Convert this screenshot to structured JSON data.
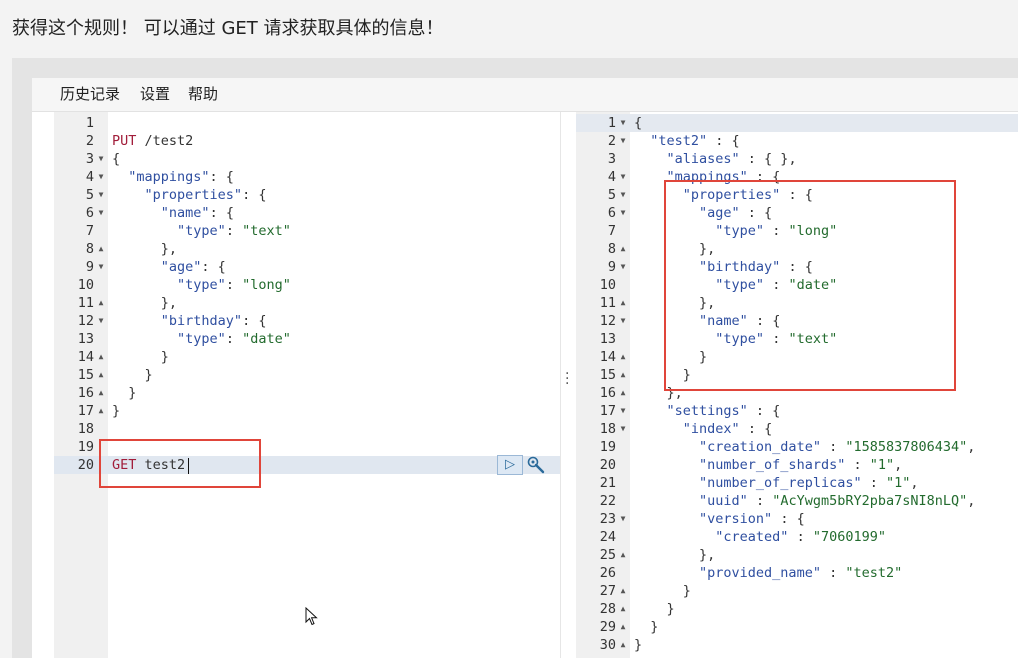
{
  "caption": "获得这个规则！ 可以通过 GET 请求获取具体的信息！",
  "menu": {
    "history": "历史记录",
    "settings": "设置",
    "help": "帮助"
  },
  "icons": {
    "run": "play-icon",
    "settings": "wrench-icon",
    "splitter": "vertical-dots-icon",
    "pointer": "mouse-cursor-icon"
  },
  "colors": {
    "accent_box": "#e0453a",
    "key": "#2f4fa0",
    "string": "#236b2e",
    "method": "#a11d3a"
  },
  "run_symbol": "▷",
  "left_editor": {
    "lines": [
      {
        "n": "1",
        "f": "",
        "t": []
      },
      {
        "n": "2",
        "f": "",
        "t": [
          [
            "m",
            "PUT"
          ],
          [
            "p",
            " /test2"
          ]
        ]
      },
      {
        "n": "3",
        "f": "▼",
        "t": [
          [
            "p",
            "{"
          ]
        ]
      },
      {
        "n": "4",
        "f": "▼",
        "t": [
          [
            "p",
            "  "
          ],
          [
            "k",
            "\"mappings\""
          ],
          [
            "p",
            ": {"
          ]
        ]
      },
      {
        "n": "5",
        "f": "▼",
        "t": [
          [
            "p",
            "    "
          ],
          [
            "k",
            "\"properties\""
          ],
          [
            "p",
            ": {"
          ]
        ]
      },
      {
        "n": "6",
        "f": "▼",
        "t": [
          [
            "p",
            "      "
          ],
          [
            "k",
            "\"name\""
          ],
          [
            "p",
            ": {"
          ]
        ]
      },
      {
        "n": "7",
        "f": "",
        "t": [
          [
            "p",
            "        "
          ],
          [
            "k",
            "\"type\""
          ],
          [
            "p",
            ": "
          ],
          [
            "s",
            "\"text\""
          ]
        ]
      },
      {
        "n": "8",
        "f": "▲",
        "t": [
          [
            "p",
            "      },"
          ]
        ]
      },
      {
        "n": "9",
        "f": "▼",
        "t": [
          [
            "p",
            "      "
          ],
          [
            "k",
            "\"age\""
          ],
          [
            "p",
            ": {"
          ]
        ]
      },
      {
        "n": "10",
        "f": "",
        "t": [
          [
            "p",
            "        "
          ],
          [
            "k",
            "\"type\""
          ],
          [
            "p",
            ": "
          ],
          [
            "s",
            "\"long\""
          ]
        ]
      },
      {
        "n": "11",
        "f": "▲",
        "t": [
          [
            "p",
            "      },"
          ]
        ]
      },
      {
        "n": "12",
        "f": "▼",
        "t": [
          [
            "p",
            "      "
          ],
          [
            "k",
            "\"birthday\""
          ],
          [
            "p",
            ": {"
          ]
        ]
      },
      {
        "n": "13",
        "f": "",
        "t": [
          [
            "p",
            "        "
          ],
          [
            "k",
            "\"type\""
          ],
          [
            "p",
            ": "
          ],
          [
            "s",
            "\"date\""
          ]
        ]
      },
      {
        "n": "14",
        "f": "▲",
        "t": [
          [
            "p",
            "      }"
          ]
        ]
      },
      {
        "n": "15",
        "f": "▲",
        "t": [
          [
            "p",
            "    }"
          ]
        ]
      },
      {
        "n": "16",
        "f": "▲",
        "t": [
          [
            "p",
            "  }"
          ]
        ]
      },
      {
        "n": "17",
        "f": "▲",
        "t": [
          [
            "p",
            "}"
          ]
        ]
      },
      {
        "n": "18",
        "f": "",
        "t": []
      },
      {
        "n": "19",
        "f": "",
        "t": []
      },
      {
        "n": "20",
        "f": "",
        "t": [
          [
            "m",
            "GET"
          ],
          [
            "p",
            " test2"
          ]
        ]
      }
    ]
  },
  "right_editor": {
    "lines": [
      {
        "n": "1",
        "f": "▼",
        "t": [
          [
            "p",
            "{"
          ]
        ]
      },
      {
        "n": "2",
        "f": "▼",
        "t": [
          [
            "p",
            "  "
          ],
          [
            "k",
            "\"test2\""
          ],
          [
            "p",
            " : {"
          ]
        ]
      },
      {
        "n": "3",
        "f": "",
        "t": [
          [
            "p",
            "    "
          ],
          [
            "k",
            "\"aliases\""
          ],
          [
            "p",
            " : { },"
          ]
        ]
      },
      {
        "n": "4",
        "f": "▼",
        "t": [
          [
            "p",
            "    "
          ],
          [
            "k",
            "\"mappings\""
          ],
          [
            "p",
            " : {"
          ]
        ]
      },
      {
        "n": "5",
        "f": "▼",
        "t": [
          [
            "p",
            "      "
          ],
          [
            "k",
            "\"properties\""
          ],
          [
            "p",
            " : {"
          ]
        ]
      },
      {
        "n": "6",
        "f": "▼",
        "t": [
          [
            "p",
            "        "
          ],
          [
            "k",
            "\"age\""
          ],
          [
            "p",
            " : {"
          ]
        ]
      },
      {
        "n": "7",
        "f": "",
        "t": [
          [
            "p",
            "          "
          ],
          [
            "k",
            "\"type\""
          ],
          [
            "p",
            " : "
          ],
          [
            "s",
            "\"long\""
          ]
        ]
      },
      {
        "n": "8",
        "f": "▲",
        "t": [
          [
            "p",
            "        },"
          ]
        ]
      },
      {
        "n": "9",
        "f": "▼",
        "t": [
          [
            "p",
            "        "
          ],
          [
            "k",
            "\"birthday\""
          ],
          [
            "p",
            " : {"
          ]
        ]
      },
      {
        "n": "10",
        "f": "",
        "t": [
          [
            "p",
            "          "
          ],
          [
            "k",
            "\"type\""
          ],
          [
            "p",
            " : "
          ],
          [
            "s",
            "\"date\""
          ]
        ]
      },
      {
        "n": "11",
        "f": "▲",
        "t": [
          [
            "p",
            "        },"
          ]
        ]
      },
      {
        "n": "12",
        "f": "▼",
        "t": [
          [
            "p",
            "        "
          ],
          [
            "k",
            "\"name\""
          ],
          [
            "p",
            " : {"
          ]
        ]
      },
      {
        "n": "13",
        "f": "",
        "t": [
          [
            "p",
            "          "
          ],
          [
            "k",
            "\"type\""
          ],
          [
            "p",
            " : "
          ],
          [
            "s",
            "\"text\""
          ]
        ]
      },
      {
        "n": "14",
        "f": "▲",
        "t": [
          [
            "p",
            "        }"
          ]
        ]
      },
      {
        "n": "15",
        "f": "▲",
        "t": [
          [
            "p",
            "      }"
          ]
        ]
      },
      {
        "n": "16",
        "f": "▲",
        "t": [
          [
            "p",
            "    },"
          ]
        ]
      },
      {
        "n": "17",
        "f": "▼",
        "t": [
          [
            "p",
            "    "
          ],
          [
            "k",
            "\"settings\""
          ],
          [
            "p",
            " : {"
          ]
        ]
      },
      {
        "n": "18",
        "f": "▼",
        "t": [
          [
            "p",
            "      "
          ],
          [
            "k",
            "\"index\""
          ],
          [
            "p",
            " : {"
          ]
        ]
      },
      {
        "n": "19",
        "f": "",
        "t": [
          [
            "p",
            "        "
          ],
          [
            "k",
            "\"creation_date\""
          ],
          [
            "p",
            " : "
          ],
          [
            "s",
            "\"1585837806434\""
          ],
          [
            "p",
            ","
          ]
        ]
      },
      {
        "n": "20",
        "f": "",
        "t": [
          [
            "p",
            "        "
          ],
          [
            "k",
            "\"number_of_shards\""
          ],
          [
            "p",
            " : "
          ],
          [
            "s",
            "\"1\""
          ],
          [
            "p",
            ","
          ]
        ]
      },
      {
        "n": "21",
        "f": "",
        "t": [
          [
            "p",
            "        "
          ],
          [
            "k",
            "\"number_of_replicas\""
          ],
          [
            "p",
            " : "
          ],
          [
            "s",
            "\"1\""
          ],
          [
            "p",
            ","
          ]
        ]
      },
      {
        "n": "22",
        "f": "",
        "t": [
          [
            "p",
            "        "
          ],
          [
            "k",
            "\"uuid\""
          ],
          [
            "p",
            " : "
          ],
          [
            "s",
            "\"AcYwgm5bRY2pba7sNI8nLQ\""
          ],
          [
            "p",
            ","
          ]
        ]
      },
      {
        "n": "23",
        "f": "▼",
        "t": [
          [
            "p",
            "        "
          ],
          [
            "k",
            "\"version\""
          ],
          [
            "p",
            " : {"
          ]
        ]
      },
      {
        "n": "24",
        "f": "",
        "t": [
          [
            "p",
            "          "
          ],
          [
            "k",
            "\"created\""
          ],
          [
            "p",
            " : "
          ],
          [
            "s",
            "\"7060199\""
          ]
        ]
      },
      {
        "n": "25",
        "f": "▲",
        "t": [
          [
            "p",
            "        },"
          ]
        ]
      },
      {
        "n": "26",
        "f": "",
        "t": [
          [
            "p",
            "        "
          ],
          [
            "k",
            "\"provided_name\""
          ],
          [
            "p",
            " : "
          ],
          [
            "s",
            "\"test2\""
          ]
        ]
      },
      {
        "n": "27",
        "f": "▲",
        "t": [
          [
            "p",
            "      }"
          ]
        ]
      },
      {
        "n": "28",
        "f": "▲",
        "t": [
          [
            "p",
            "    }"
          ]
        ]
      },
      {
        "n": "29",
        "f": "▲",
        "t": [
          [
            "p",
            "  }"
          ]
        ]
      },
      {
        "n": "30",
        "f": "▲",
        "t": [
          [
            "p",
            "}"
          ]
        ]
      }
    ]
  }
}
